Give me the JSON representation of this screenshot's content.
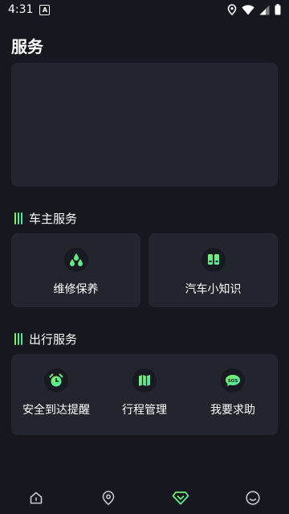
{
  "status_bar": {
    "time": "4:31",
    "notification_badge": "A"
  },
  "page": {
    "title": "服务"
  },
  "sections": {
    "owner": {
      "title": "车主服务",
      "items": [
        {
          "label": "维修保养",
          "icon": "droplets-icon"
        },
        {
          "label": "汽车小知识",
          "icon": "book-icon"
        }
      ]
    },
    "travel": {
      "title": "出行服务",
      "items": [
        {
          "label": "安全到达提醒",
          "icon": "alarm-clock-icon"
        },
        {
          "label": "行程管理",
          "icon": "map-icon"
        },
        {
          "label": "我要求助",
          "icon": "sos-icon"
        }
      ]
    }
  },
  "tab_bar": {
    "items": [
      {
        "icon": "home-icon"
      },
      {
        "icon": "location-icon"
      },
      {
        "icon": "diamond-icon",
        "active": true
      },
      {
        "icon": "smiley-icon"
      }
    ]
  },
  "colors": {
    "background": "#16171f",
    "card": "#22242e",
    "accent_green": "#7ef25c",
    "accent_teal": "#49e6b0",
    "tab_inactive": "#c8c8cc"
  }
}
